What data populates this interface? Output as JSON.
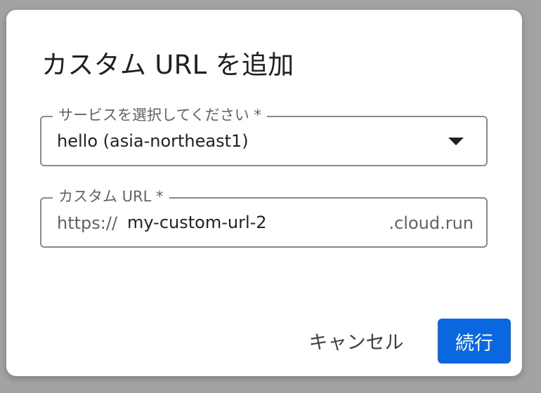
{
  "dialog": {
    "title": "カスタム URL を追加",
    "service_field": {
      "label": "サービスを選択してください *",
      "value": "hello (asia-northeast1)",
      "icon": "arrow-drop-down-icon"
    },
    "url_field": {
      "label": "カスタム URL *",
      "prefix": "https://",
      "value": "my-custom-url-2",
      "suffix": ".cloud.run"
    },
    "actions": {
      "cancel_label": "キャンセル",
      "continue_label": "続行"
    }
  },
  "colors": {
    "primary": "#0b67e0",
    "backdrop": "#a3a3a3",
    "border": "#8a8a8a"
  }
}
